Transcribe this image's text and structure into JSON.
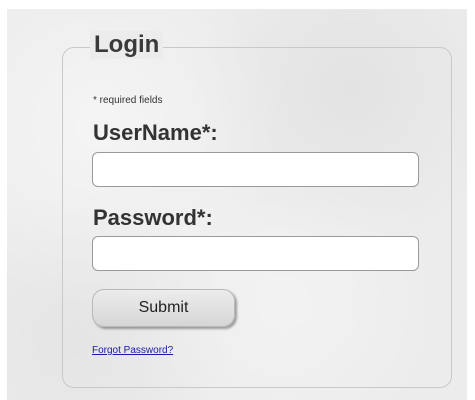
{
  "login": {
    "title": "Login",
    "required_note": "* required fields",
    "username_label": "UserName*:",
    "username_value": "",
    "password_label": "Password*:",
    "password_value": "",
    "submit_label": "Submit",
    "forgot_password_link": "Forgot Password?"
  }
}
